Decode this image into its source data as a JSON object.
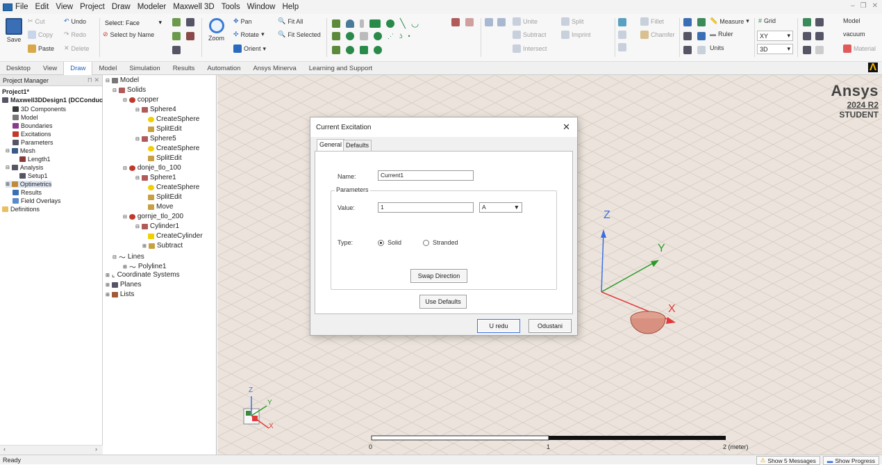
{
  "menu": [
    "File",
    "Edit",
    "View",
    "Project",
    "Draw",
    "Modeler",
    "Maxwell 3D",
    "Tools",
    "Window",
    "Help"
  ],
  "ribbon": {
    "save": "Save",
    "cut": "Cut",
    "copy": "Copy",
    "paste": "Paste",
    "undo": "Undo",
    "redo": "Redo",
    "delete": "Delete",
    "select_face": "Select: Face",
    "select_by_name": "Select by Name",
    "zoom": "Zoom",
    "pan": "Pan",
    "rotate": "Rotate",
    "orient": "Orient",
    "fit_all": "Fit All",
    "fit_selected": "Fit Selected",
    "unite": "Unite",
    "subtract": "Subtract",
    "intersect": "Intersect",
    "split": "Split",
    "imprint": "Imprint",
    "fillet": "Fillet",
    "chamfer": "Chamfer",
    "measure": "Measure",
    "ruler": "Ruler",
    "units": "Units",
    "grid": "Grid",
    "plane": "XY",
    "dim": "3D",
    "model_label": "Model",
    "material_value": "vacuum",
    "material": "Material"
  },
  "tabs": [
    "Desktop",
    "View",
    "Draw",
    "Model",
    "Simulation",
    "Results",
    "Automation",
    "Ansys Minerva",
    "Learning and Support"
  ],
  "active_tab": "Draw",
  "project_manager": {
    "header": "Project Manager",
    "project": "Project1*",
    "design": "Maxwell3DDesign1 (DCConduc",
    "items": [
      "3D Components",
      "Model",
      "Boundaries",
      "Excitations",
      "Parameters",
      "Mesh",
      "Length1",
      "Analysis",
      "Setup1",
      "Optimetrics",
      "Results",
      "Field Overlays"
    ],
    "definitions": "Definitions"
  },
  "model_tree": [
    "Model",
    "Solids",
    "copper",
    "Sphere4",
    "CreateSphere",
    "SplitEdit",
    "Sphere5",
    "CreateSphere",
    "SplitEdit",
    "donje_tlo_100",
    "Sphere1",
    "CreateSphere",
    "SplitEdit",
    "Move",
    "gornje_tlo_200",
    "Cylinder1",
    "CreateCylinder",
    "Subtract",
    "Lines",
    "Polyline1",
    "Coordinate Systems",
    "Planes",
    "Lists"
  ],
  "logo": {
    "brand": "Ansys",
    "version": "2024 R2",
    "edition": "STUDENT"
  },
  "axes": {
    "x": "X",
    "y": "Y",
    "z": "Z"
  },
  "scale_bar": {
    "labels": [
      "0",
      "1",
      "2 (meter)"
    ]
  },
  "dialog": {
    "title": "Current Excitation",
    "tabs": [
      "General",
      "Defaults"
    ],
    "name_label": "Name:",
    "name_value": "Current1",
    "parameters_label": "Parameters",
    "value_label": "Value:",
    "value": "1",
    "unit": "A",
    "type_label": "Type:",
    "solid": "Solid",
    "stranded": "Stranded",
    "type_selected": "Solid",
    "swap": "Swap Direction",
    "use_defaults": "Use Defaults",
    "ok": "U redu",
    "cancel": "Odustani"
  },
  "status": {
    "text": "Ready",
    "messages": "Show 5 Messages",
    "progress": "Show Progress"
  }
}
